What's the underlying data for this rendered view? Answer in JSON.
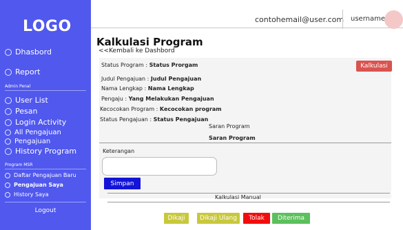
{
  "sidebar": {
    "logo": "LOGO",
    "items": [
      {
        "label": "Dhasbord"
      },
      {
        "label": "Report"
      }
    ],
    "admin_section": "Admin Penal",
    "admin_items": [
      {
        "label": "User List"
      },
      {
        "label": "Pesan"
      },
      {
        "label": "Login Activity"
      },
      {
        "label": "All Pengajuan"
      },
      {
        "label": "Pengajuan"
      },
      {
        "label": "History Program"
      }
    ],
    "msr_section": "Program MSR",
    "msr_items": [
      {
        "label": "Daftar Pengajuan Baru"
      },
      {
        "label": "Pengajuan Saya"
      },
      {
        "label": "History Saya"
      }
    ],
    "logout": "Logout"
  },
  "header": {
    "email": "contohemail@user.com",
    "username": "username"
  },
  "main": {
    "title": "Kalkulasi Program",
    "back_link": "<<Kembali ke Dashbord",
    "status_program_label": "Status Program :",
    "status_program_value": "Status Prorgam",
    "kalkulasi_button": "Kalkulasi",
    "judul_label": "Judul Pengajuan :",
    "judul_value": "Judul Pengajuan",
    "nama_label": "Nama Lengkap :",
    "nama_value": "Nama Lengkap",
    "pengaju_label": "Pengaju :",
    "pengaju_value": "Yang Melakukan Pengajuan",
    "kecocokan_label": "Kecocokan Program :",
    "kecocokan_value": "Kecocokan program",
    "status_pengajuan_label": "Status Pengajuan :",
    "status_pengajuan_value": "Status Pengajuan",
    "saran_label": "Saran Program",
    "saran_value": "Saran Program",
    "keterangan_label": "Keterangan",
    "simpan_button": "Simpan",
    "kalkulasi_manual": "Kalkulasi Manual",
    "actions": {
      "dikaji": "Dikaji",
      "dikaji_ulang": "Dikaji Ulang",
      "tolak": "Tolak",
      "diterima": "Diterima"
    }
  },
  "colors": {
    "sidebar": "#5058ee",
    "kalkulasi": "#d9534f",
    "simpan": "#1414d8",
    "dikaji": "#c8c83c",
    "tolak": "#f20d0d",
    "diterima": "#5cc05c"
  }
}
